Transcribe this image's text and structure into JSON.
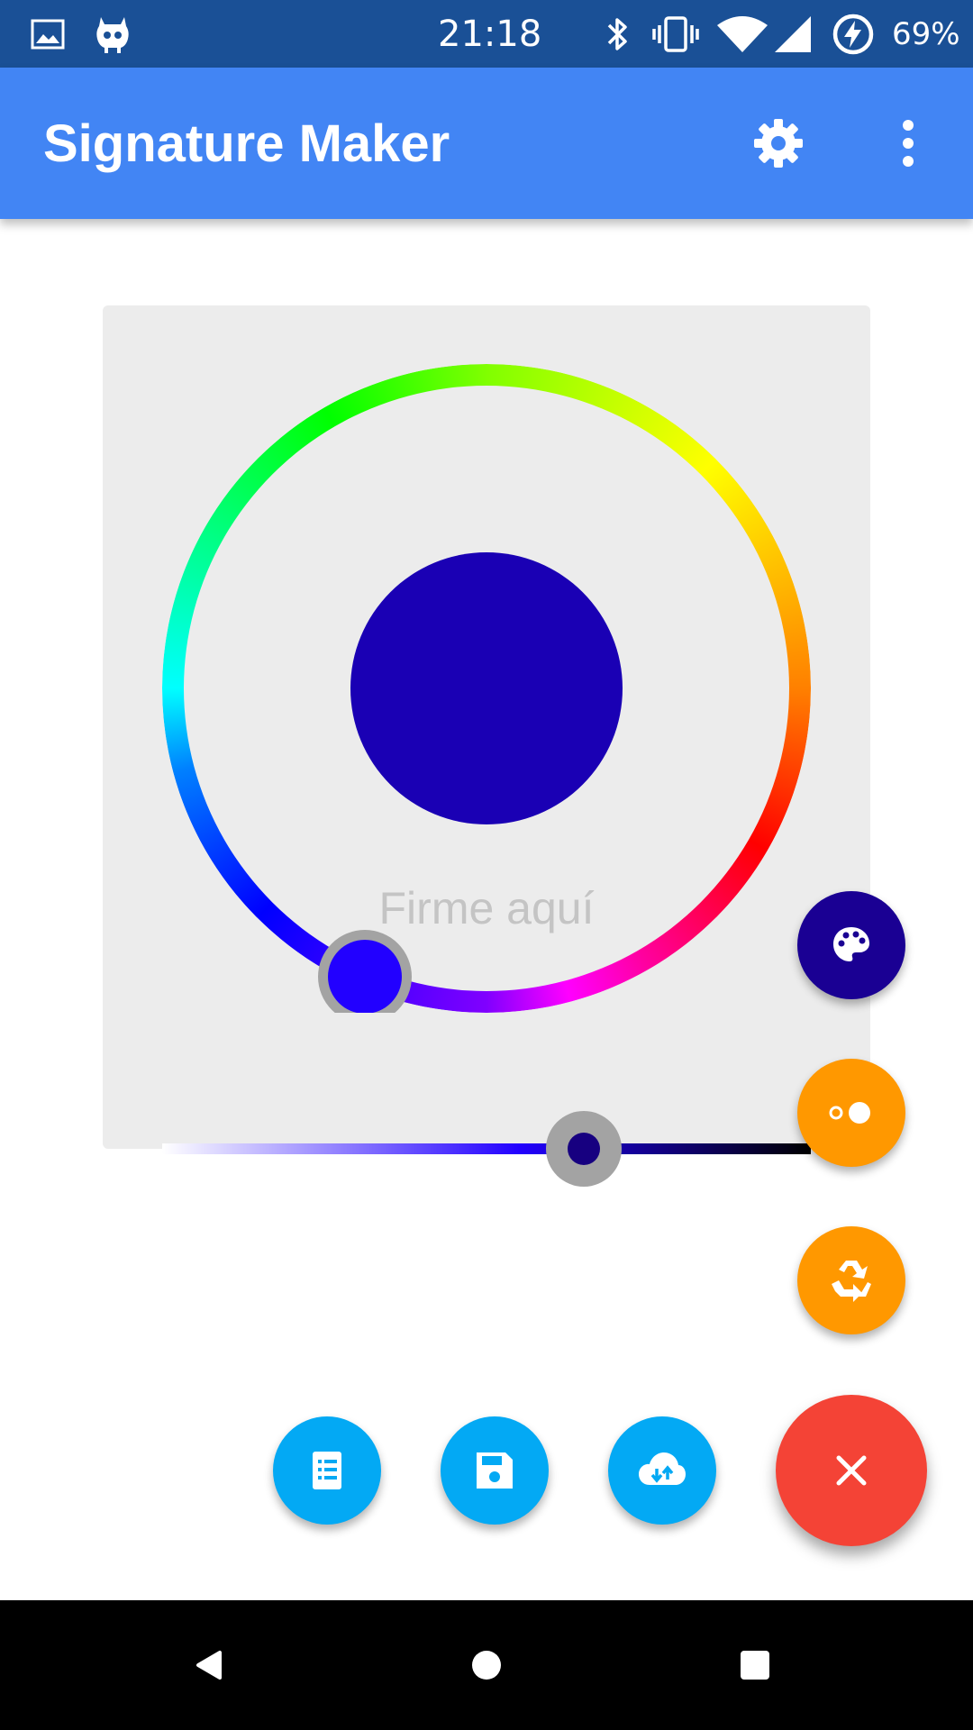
{
  "status_bar": {
    "time": "21:18",
    "battery_percent": "69%",
    "icons": [
      "gallery-icon",
      "cyanogen-mascot-icon",
      "bluetooth-icon",
      "vibrate-icon",
      "wifi-icon",
      "cell-signal-icon",
      "battery-charging-icon"
    ]
  },
  "app_bar": {
    "title": "Signature Maker",
    "actions": [
      "settings-icon",
      "more-vert-icon"
    ]
  },
  "color_picker": {
    "signature_hint": "Firme aquí",
    "selected_color": "#1a00b4",
    "hue_handle_color": "#2200ff",
    "value_slider_fraction": 0.64
  },
  "fab_menu": {
    "vertical": [
      {
        "icon": "palette-icon",
        "color": "#1a0093"
      },
      {
        "icon": "stroke-width-icon",
        "color": "#ff9800"
      },
      {
        "icon": "recycle-icon",
        "color": "#ff9800"
      }
    ],
    "horizontal": [
      {
        "icon": "checklist-icon",
        "color": "#03a9f4"
      },
      {
        "icon": "save-icon",
        "color": "#03a9f4"
      },
      {
        "icon": "cloud-sync-icon",
        "color": "#03a9f4"
      }
    ],
    "main": {
      "icon": "close-icon",
      "color": "#f44336"
    }
  },
  "nav_bar": {
    "buttons": [
      "back-icon",
      "home-icon",
      "recents-icon"
    ]
  }
}
